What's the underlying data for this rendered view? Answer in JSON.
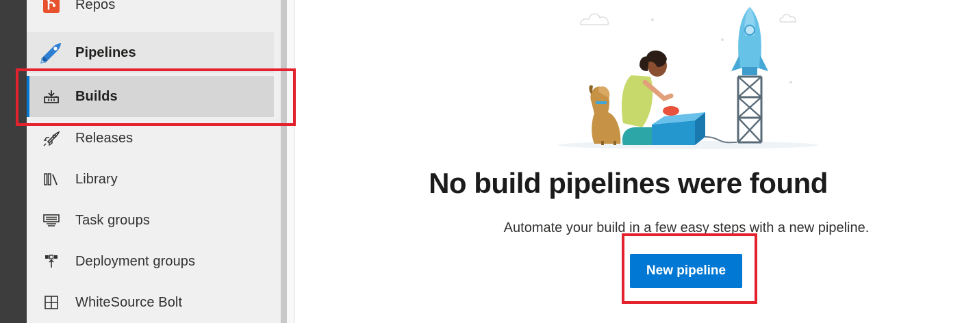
{
  "sidebar": {
    "items": [
      {
        "label": "Repos",
        "icon": "repos-icon"
      },
      {
        "label": "Pipelines",
        "icon": "pipelines-icon"
      },
      {
        "label": "Builds",
        "icon": "builds-icon"
      },
      {
        "label": "Releases",
        "icon": "releases-icon"
      },
      {
        "label": "Library",
        "icon": "library-icon"
      },
      {
        "label": "Task groups",
        "icon": "task-groups-icon"
      },
      {
        "label": "Deployment groups",
        "icon": "deployment-groups-icon"
      },
      {
        "label": "WhiteSource Bolt",
        "icon": "whitesource-bolt-icon"
      }
    ]
  },
  "main": {
    "title": "No build pipelines were found",
    "subtitle": "Automate your build in a few easy steps with a new pipeline.",
    "new_pipeline_label": "New pipeline"
  },
  "colors": {
    "accent": "#0078d4",
    "annotation_red": "#e3222d",
    "sidebar_bg": "#f0f0f0"
  }
}
